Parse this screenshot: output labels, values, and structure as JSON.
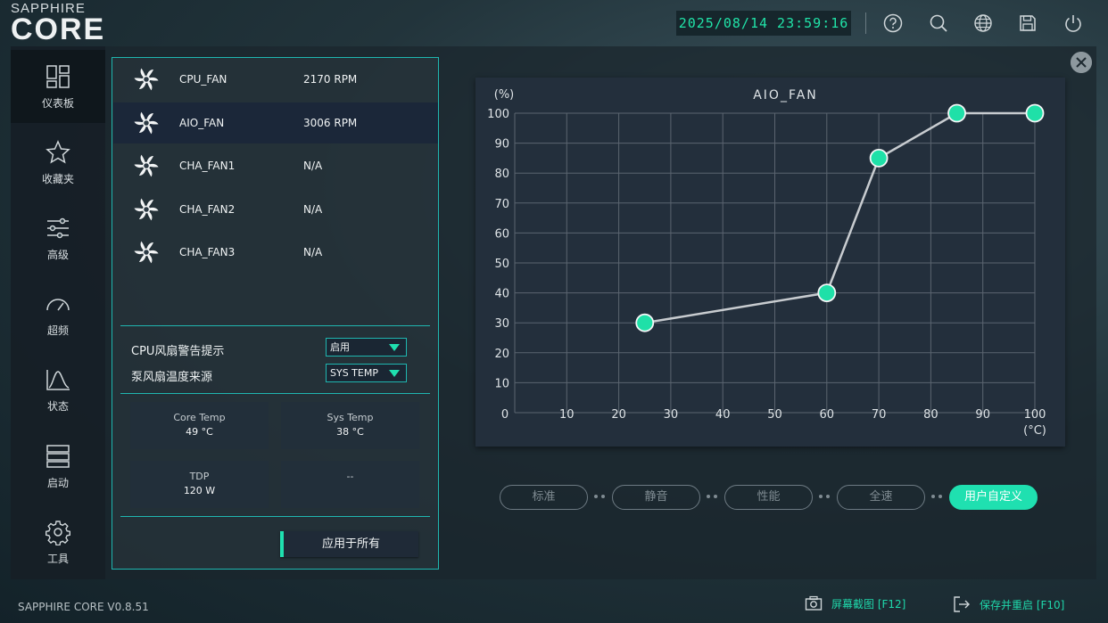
{
  "brand": {
    "top": "SAPPHIRE",
    "main": "CORE"
  },
  "header": {
    "datetime": "2025/08/14 23:59:16",
    "icons": [
      "help-icon",
      "search-icon",
      "language-icon",
      "save-icon",
      "power-icon"
    ]
  },
  "sidebar": {
    "items": [
      {
        "label": "仪表板",
        "icon": "dashboard-icon"
      },
      {
        "label": "收藏夹",
        "icon": "star-icon"
      },
      {
        "label": "高级",
        "icon": "sliders-icon"
      },
      {
        "label": "超频",
        "icon": "gauge-icon"
      },
      {
        "label": "状态",
        "icon": "graph-icon"
      },
      {
        "label": "启动",
        "icon": "startup-icon"
      },
      {
        "label": "工具",
        "icon": "gear-icon"
      }
    ],
    "active_index": 0
  },
  "fans": [
    {
      "name": "CPU_FAN",
      "rpm": "2170 RPM"
    },
    {
      "name": "AIO_FAN",
      "rpm": "3006 RPM"
    },
    {
      "name": "CHA_FAN1",
      "rpm": "N/A"
    },
    {
      "name": "CHA_FAN2",
      "rpm": "N/A"
    },
    {
      "name": "CHA_FAN3",
      "rpm": "N/A"
    }
  ],
  "selected_fan_index": 1,
  "settings": {
    "cpu_warning_label": "CPU风扇警告提示",
    "cpu_warning_value": "启用",
    "pump_source_label": "泵风扇温度来源",
    "pump_source_value": "SYS TEMP"
  },
  "stats": [
    {
      "title": "Core Temp",
      "value": "49 °C"
    },
    {
      "title": "Sys Temp",
      "value": "38 °C"
    },
    {
      "title": "TDP",
      "value": "120 W"
    },
    {
      "title": "--",
      "value": ""
    }
  ],
  "apply_button": "应用于所有",
  "chart_data": {
    "type": "line",
    "title": "AIO_FAN",
    "ylabel": "(%)",
    "xlabel": "(°C)",
    "x_ticks": [
      "0",
      "10",
      "20",
      "30",
      "40",
      "50",
      "60",
      "70",
      "80",
      "90",
      "100"
    ],
    "y_ticks": [
      "10",
      "20",
      "30",
      "40",
      "50",
      "60",
      "70",
      "80",
      "90",
      "100"
    ],
    "xlim": [
      0,
      100
    ],
    "ylim": [
      0,
      100
    ],
    "grid": true,
    "series": [
      {
        "x": [
          25,
          60,
          70,
          85,
          100
        ],
        "y": [
          30,
          40,
          85,
          100,
          100
        ]
      }
    ],
    "colors": {
      "point": "#1fe0a8",
      "line": "#c8ccd0",
      "grid": "#5b6570"
    }
  },
  "modes": [
    {
      "label": "标准"
    },
    {
      "label": "静音"
    },
    {
      "label": "性能"
    },
    {
      "label": "全速"
    },
    {
      "label": "用户自定义"
    }
  ],
  "active_mode_index": 4,
  "footer": {
    "version": "SAPPHIRE CORE V0.8.51",
    "screenshot": "屏幕截图 [F12]",
    "save_restart": "保存并重启 [F10]"
  },
  "accent_color": "#1fe0b0"
}
